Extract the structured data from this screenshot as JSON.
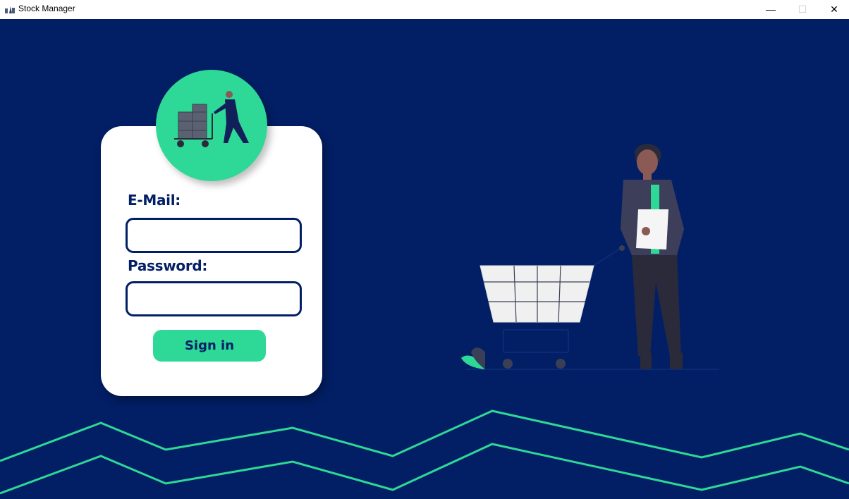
{
  "window": {
    "title": "Stock Manager",
    "minimize_glyph": "—",
    "maximize_glyph": "☐",
    "close_glyph": "✕"
  },
  "login": {
    "email_label": "E-Mail:",
    "email_value": "",
    "password_label": "Password:",
    "password_value": "",
    "signin_label": "Sign in"
  },
  "colors": {
    "background": "#021f66",
    "accent": "#2ed897",
    "card": "#ffffff"
  },
  "icons": {
    "app": "warehouse-worker-icon",
    "avatar": "worker-pushing-boxes-illustration",
    "illustration": "person-with-shopping-cart-illustration"
  }
}
